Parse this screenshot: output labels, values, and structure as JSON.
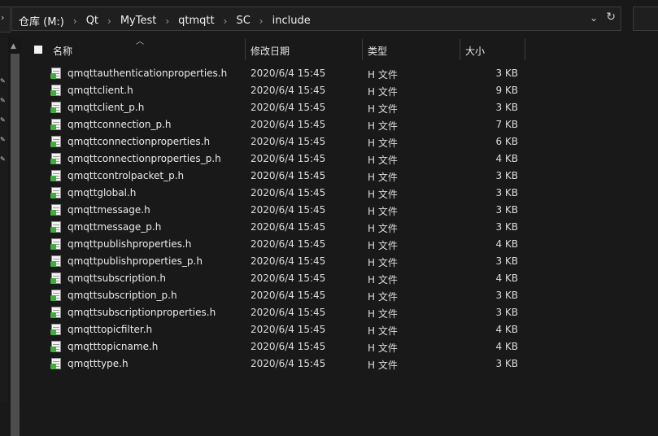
{
  "address": {
    "crumbs": [
      "仓库 (M:)",
      "Qt",
      "MyTest",
      "qtmqtt",
      "SC",
      "include"
    ]
  },
  "columns": {
    "name": "名称",
    "date": "修改日期",
    "type": "类型",
    "size": "大小"
  },
  "files": [
    {
      "name": "qmqttauthenticationproperties.h",
      "date": "2020/6/4 15:45",
      "type": "H 文件",
      "size": "3 KB"
    },
    {
      "name": "qmqttclient.h",
      "date": "2020/6/4 15:45",
      "type": "H 文件",
      "size": "9 KB"
    },
    {
      "name": "qmqttclient_p.h",
      "date": "2020/6/4 15:45",
      "type": "H 文件",
      "size": "3 KB"
    },
    {
      "name": "qmqttconnection_p.h",
      "date": "2020/6/4 15:45",
      "type": "H 文件",
      "size": "7 KB"
    },
    {
      "name": "qmqttconnectionproperties.h",
      "date": "2020/6/4 15:45",
      "type": "H 文件",
      "size": "6 KB"
    },
    {
      "name": "qmqttconnectionproperties_p.h",
      "date": "2020/6/4 15:45",
      "type": "H 文件",
      "size": "4 KB"
    },
    {
      "name": "qmqttcontrolpacket_p.h",
      "date": "2020/6/4 15:45",
      "type": "H 文件",
      "size": "3 KB"
    },
    {
      "name": "qmqttglobal.h",
      "date": "2020/6/4 15:45",
      "type": "H 文件",
      "size": "3 KB"
    },
    {
      "name": "qmqttmessage.h",
      "date": "2020/6/4 15:45",
      "type": "H 文件",
      "size": "3 KB"
    },
    {
      "name": "qmqttmessage_p.h",
      "date": "2020/6/4 15:45",
      "type": "H 文件",
      "size": "3 KB"
    },
    {
      "name": "qmqttpublishproperties.h",
      "date": "2020/6/4 15:45",
      "type": "H 文件",
      "size": "4 KB"
    },
    {
      "name": "qmqttpublishproperties_p.h",
      "date": "2020/6/4 15:45",
      "type": "H 文件",
      "size": "3 KB"
    },
    {
      "name": "qmqttsubscription.h",
      "date": "2020/6/4 15:45",
      "type": "H 文件",
      "size": "4 KB"
    },
    {
      "name": "qmqttsubscription_p.h",
      "date": "2020/6/4 15:45",
      "type": "H 文件",
      "size": "3 KB"
    },
    {
      "name": "qmqttsubscriptionproperties.h",
      "date": "2020/6/4 15:45",
      "type": "H 文件",
      "size": "3 KB"
    },
    {
      "name": "qmqtttopicfilter.h",
      "date": "2020/6/4 15:45",
      "type": "H 文件",
      "size": "4 KB"
    },
    {
      "name": "qmqtttopicname.h",
      "date": "2020/6/4 15:45",
      "type": "H 文件",
      "size": "4 KB"
    },
    {
      "name": "qmqtttype.h",
      "date": "2020/6/4 15:45",
      "type": "H 文件",
      "size": "3 KB"
    }
  ],
  "icons": {
    "file": "header-file-icon",
    "refresh": "refresh-icon",
    "dropdown": "chevron-down-icon",
    "pin": "pin-icon"
  }
}
